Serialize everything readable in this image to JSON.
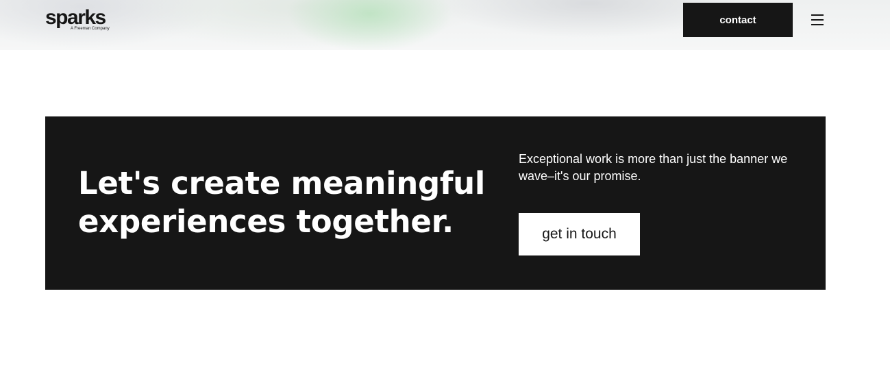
{
  "header": {
    "logo": {
      "word": "sparks",
      "tagline": "A Freeman Company"
    },
    "contact_label": "contact",
    "menu_icon": "hamburger-menu-icon"
  },
  "cta": {
    "heading": "Let's create meaningful experiences together.",
    "text": "Exceptional work is more than just the banner we wave–it's our promise.",
    "button_label": "get in touch"
  },
  "colors": {
    "dark": "#161616",
    "background": "#ffffff",
    "header_bg": "#f3f4f4",
    "accent_green_glow": "#b4e1b9"
  }
}
